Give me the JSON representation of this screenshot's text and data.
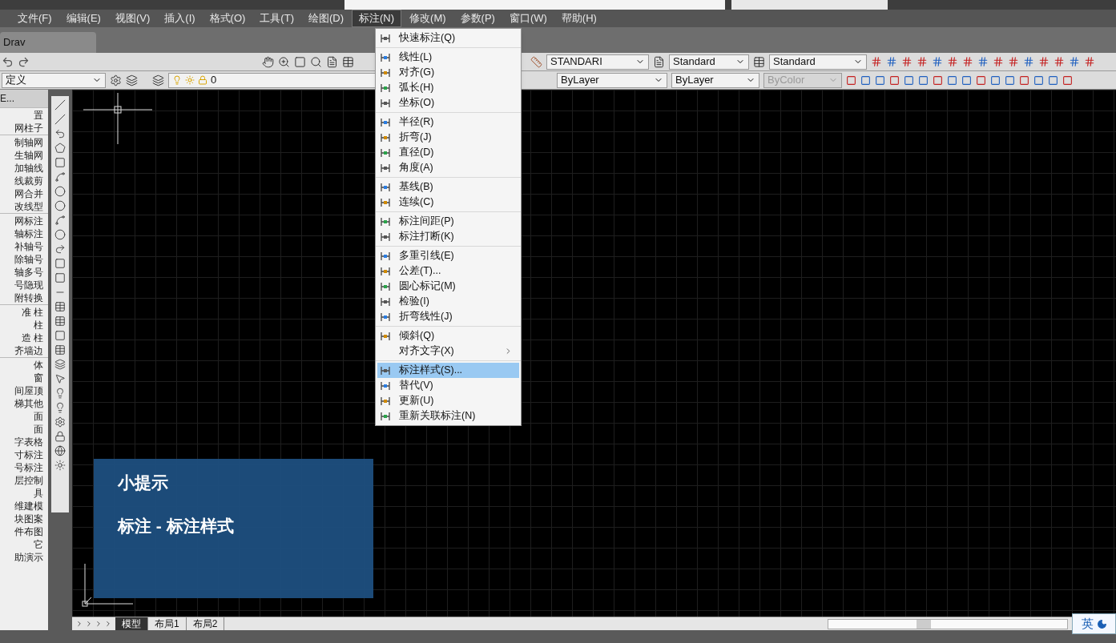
{
  "menu_bar": [
    {
      "label": "文件(F)",
      "selected": false
    },
    {
      "label": "编辑(E)",
      "selected": false
    },
    {
      "label": "视图(V)",
      "selected": false
    },
    {
      "label": "插入(I)",
      "selected": false
    },
    {
      "label": "格式(O)",
      "selected": false
    },
    {
      "label": "工具(T)",
      "selected": false
    },
    {
      "label": "绘图(D)",
      "selected": false
    },
    {
      "label": "标注(N)",
      "selected": true
    },
    {
      "label": "修改(M)",
      "selected": false
    },
    {
      "label": "参数(P)",
      "selected": false
    },
    {
      "label": "窗口(W)",
      "selected": false
    },
    {
      "label": "帮助(H)",
      "selected": false
    }
  ],
  "file_tab": {
    "label": "Drav"
  },
  "styles_toolbar": {
    "text_style": "STANDARI",
    "dim_style": "Standard",
    "table_style": "Standard"
  },
  "properties_toolbar": {
    "workspace": "定义",
    "layer": "0",
    "linetype": "ByLayer",
    "lineweight": "ByLayer",
    "plot_style": {
      "value": "ByColor",
      "disabled": true
    }
  },
  "left_panel": {
    "title": "E...",
    "groups": [
      [
        "置",
        "网柱子"
      ],
      [
        "制轴网",
        "生轴网",
        "加轴线",
        "线裁剪",
        "网合并",
        "改线型"
      ],
      [
        "网标注",
        "轴标注",
        "补轴号",
        "除轴号",
        "轴多号",
        "号隐现",
        "附转换"
      ],
      [
        "准 柱",
        "柱",
        "造 柱",
        "齐墙边"
      ],
      [
        "体",
        "窗",
        "间屋顶",
        "梯其他",
        "面",
        "面",
        "字表格",
        "寸标注",
        "号标注",
        "层控制",
        "具",
        "维建模",
        "块图案",
        "件布图",
        "它",
        "助演示"
      ]
    ]
  },
  "dim_menu": [
    [
      {
        "label": "快速标注(Q)",
        "has_icon": true,
        "submenu": false,
        "selected": false
      }
    ],
    [
      {
        "label": "线性(L)",
        "has_icon": true,
        "submenu": false,
        "selected": false
      },
      {
        "label": "对齐(G)",
        "has_icon": true,
        "submenu": false,
        "selected": false
      },
      {
        "label": "弧长(H)",
        "has_icon": true,
        "submenu": false,
        "selected": false
      },
      {
        "label": "坐标(O)",
        "has_icon": true,
        "submenu": false,
        "selected": false
      }
    ],
    [
      {
        "label": "半径(R)",
        "has_icon": true,
        "submenu": false,
        "selected": false
      },
      {
        "label": "折弯(J)",
        "has_icon": true,
        "submenu": false,
        "selected": false
      },
      {
        "label": "直径(D)",
        "has_icon": true,
        "submenu": false,
        "selected": false
      },
      {
        "label": "角度(A)",
        "has_icon": true,
        "submenu": false,
        "selected": false
      }
    ],
    [
      {
        "label": "基线(B)",
        "has_icon": true,
        "submenu": false,
        "selected": false
      },
      {
        "label": "连续(C)",
        "has_icon": true,
        "submenu": false,
        "selected": false
      }
    ],
    [
      {
        "label": "标注间距(P)",
        "has_icon": true,
        "submenu": false,
        "selected": false
      },
      {
        "label": "标注打断(K)",
        "has_icon": true,
        "submenu": false,
        "selected": false
      }
    ],
    [
      {
        "label": "多重引线(E)",
        "has_icon": true,
        "submenu": false,
        "selected": false
      },
      {
        "label": "公差(T)...",
        "has_icon": true,
        "submenu": false,
        "selected": false
      },
      {
        "label": "圆心标记(M)",
        "has_icon": true,
        "submenu": false,
        "selected": false
      },
      {
        "label": "检验(I)",
        "has_icon": true,
        "submenu": false,
        "selected": false
      },
      {
        "label": "折弯线性(J)",
        "has_icon": true,
        "submenu": false,
        "selected": false
      }
    ],
    [
      {
        "label": "倾斜(Q)",
        "has_icon": true,
        "submenu": false,
        "selected": false
      },
      {
        "label": "对齐文字(X)",
        "has_icon": false,
        "submenu": true,
        "selected": false
      }
    ],
    [
      {
        "label": "标注样式(S)...",
        "has_icon": true,
        "submenu": false,
        "selected": true
      },
      {
        "label": "替代(V)",
        "has_icon": true,
        "submenu": false,
        "selected": false
      },
      {
        "label": "更新(U)",
        "has_icon": true,
        "submenu": false,
        "selected": false
      },
      {
        "label": "重新关联标注(N)",
        "has_icon": true,
        "submenu": false,
        "selected": false
      }
    ]
  ],
  "tip": {
    "title": "小提示",
    "body": "标注 - 标注样式"
  },
  "layout_tabs": [
    {
      "label": "模型",
      "selected": true
    },
    {
      "label": "布局1",
      "selected": false
    },
    {
      "label": "布局2",
      "selected": false
    }
  ],
  "ime": {
    "label": "英"
  }
}
